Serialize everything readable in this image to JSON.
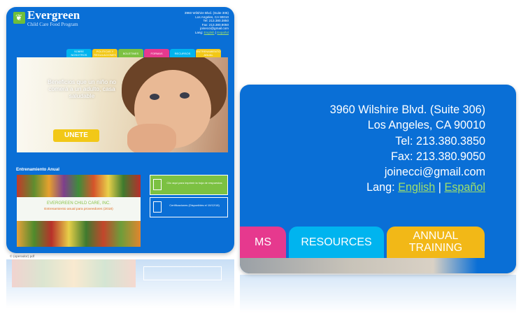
{
  "brand": {
    "name": "Evergreen",
    "subtitle": "Child Care Food Program"
  },
  "address": {
    "line1": "3960 Wilshire Blvd. (Suite 306)",
    "line2": "Los Angeles, CA 90010",
    "tel": "Tel: 213.380.3850",
    "fax": "Fax: 213.380.9050",
    "email": "joinecci@gmail.com",
    "lang_label": "Lang:",
    "lang_en": "English",
    "lang_sep": "|",
    "lang_es": "Español"
  },
  "nav_small": [
    {
      "label": "SOBRE NOSOTROS",
      "color": "#00b4ef"
    },
    {
      "label": "POLITICAS Y REGULACIONES",
      "color": "#f2c817"
    },
    {
      "label": "BOLETINES",
      "color": "#7cc142"
    },
    {
      "label": "FORMAS",
      "color": "#e6398e"
    },
    {
      "label": "RECURSOS",
      "color": "#00b4ef"
    },
    {
      "label": "ENTRENAMIENTO ANUAL",
      "color": "#f2c817"
    }
  ],
  "hero": {
    "text": "Beneficios que un niño no comerá a un adulto, casa saludable",
    "cta": "UNETE"
  },
  "training": {
    "section_title": "Entrenamiento Anual",
    "heading": "EVERGREEN CHILD CARE, INC.",
    "subheading": "Entrenamiento anual para proveedores (2018)"
  },
  "side_buttons": {
    "print": "Clic aquí para imprimir la hoja de respuestas",
    "certifications": "Certificaciones (Disponibles el 10/12/18)"
  },
  "caption": "© (operador) pdf",
  "nav_big": [
    {
      "label": "MS",
      "color": "#e6398e"
    },
    {
      "label": "RESOURCES",
      "color": "#00b4ef"
    },
    {
      "label": "ANNUAL TRAINING",
      "color": "#f2b817"
    }
  ],
  "colors": {
    "brand_blue": "#0a6fd6",
    "accent_green": "#7cc142",
    "accent_yellow": "#f2c817",
    "link_green": "#9fe06a"
  }
}
